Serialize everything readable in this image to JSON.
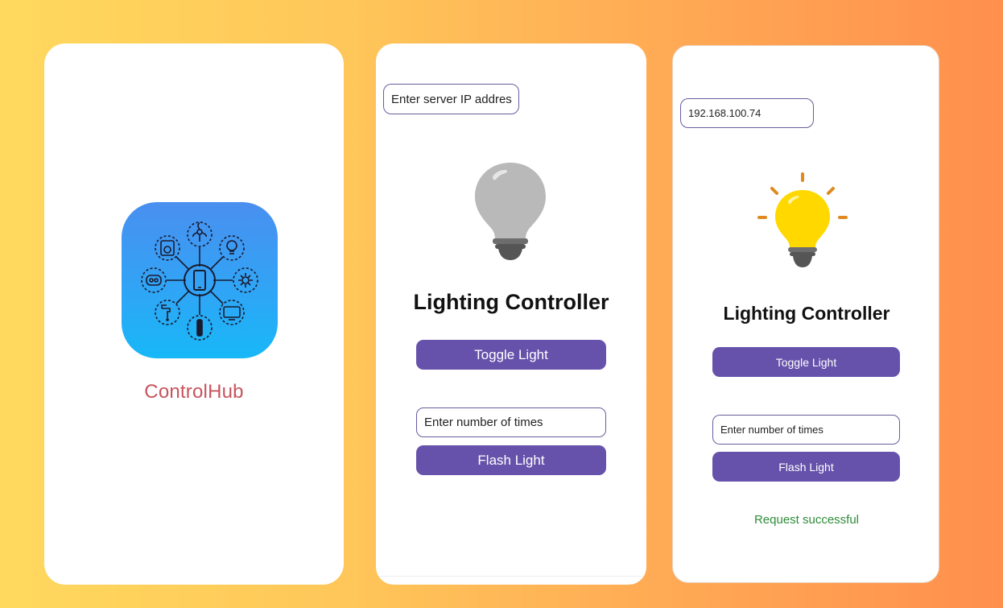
{
  "splash": {
    "app_name": "ControlHub"
  },
  "screen_initial": {
    "server_ip_placeholder": "Enter server IP addres",
    "bulb_state": "off",
    "title": "Lighting Controller",
    "toggle_label": "Toggle Light",
    "times_placeholder": "Enter number of times",
    "flash_label": "Flash Light"
  },
  "screen_connected": {
    "server_ip_value": "192.168.100.74",
    "bulb_state": "on",
    "title": "Lighting Controller",
    "toggle_label": "Toggle Light",
    "times_placeholder": "Enter number of times",
    "flash_label": "Flash Light",
    "status": "Request successful"
  },
  "colors": {
    "button": "#6652ab",
    "input_border": "#6a5c9e",
    "success": "#2e8b3a",
    "brand_text": "#c7545d",
    "bulb_off": "#b9b9b9",
    "bulb_on": "#ffd800"
  },
  "icons": {
    "app_icon": "smart-home-hub-icon",
    "bulb_off": "light-bulb-off-icon",
    "bulb_on": "light-bulb-on-icon"
  }
}
